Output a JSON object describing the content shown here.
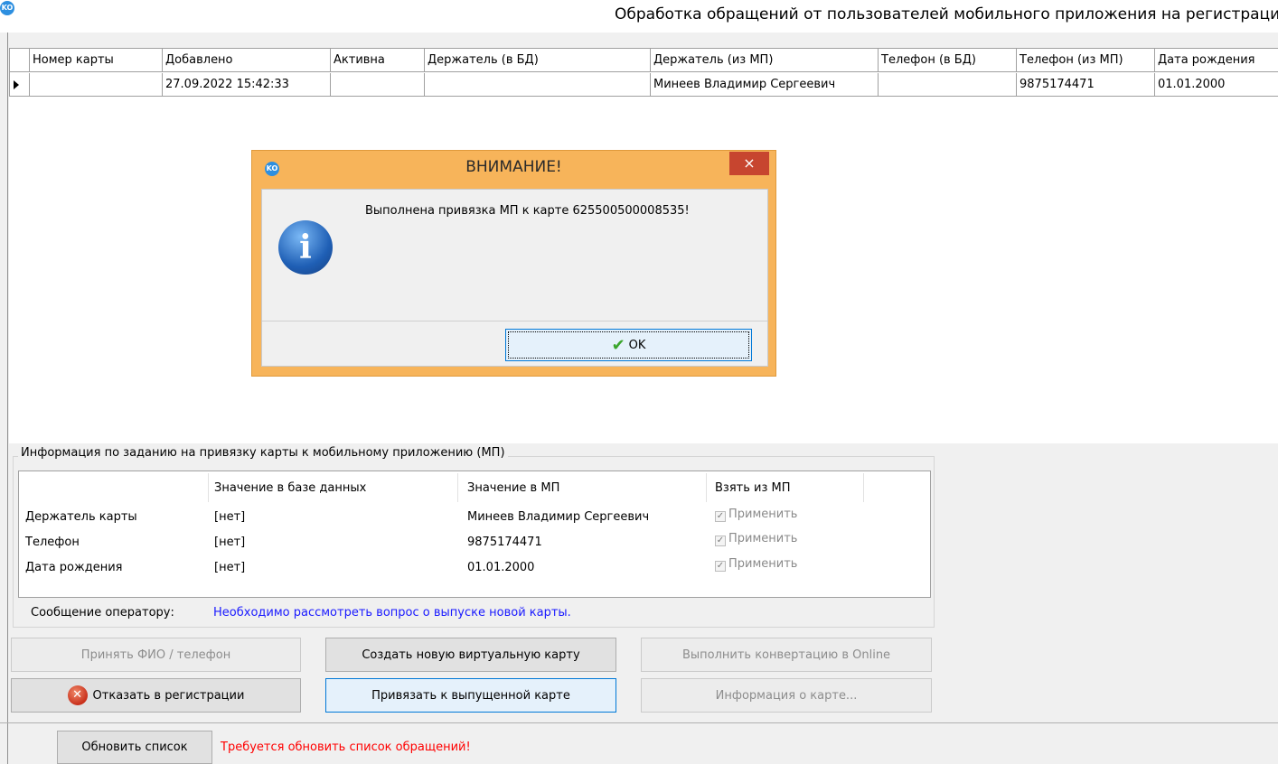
{
  "window": {
    "app_icon": "KO",
    "title": "Обработка обращений от пользователей мобильного приложения на регистрацию карт"
  },
  "grid": {
    "columns": [
      "Номер карты",
      "Добавлено",
      "Активна",
      "Держатель (в БД)",
      "Держатель (из МП)",
      "Телефон (в БД)",
      "Телефон (из МП)",
      "Дата рождения"
    ],
    "rows": [
      [
        "",
        "27.09.2022 15:42:33",
        "",
        "",
        "Минеев Владимир Сергеевич",
        "",
        "9875174471",
        "01.01.2000"
      ]
    ]
  },
  "info": {
    "group_title": "Информация по заданию на привязку карты к мобильному приложению (МП)",
    "headers": {
      "db": "Значение в базе данных",
      "mp": "Значение в МП",
      "take": "Взять из МП"
    },
    "rows": [
      {
        "label": "Держатель карты",
        "db": "[нет]",
        "mp": "Минеев Владимир Сергеевич",
        "apply": "Применить",
        "checked": true
      },
      {
        "label": "Телефон",
        "db": "[нет]",
        "mp": "9875174471",
        "apply": "Применить",
        "checked": true
      },
      {
        "label": "Дата рождения",
        "db": "[нет]",
        "mp": "01.01.2000",
        "apply": "Применить",
        "checked": true
      }
    ],
    "operator_label": "Сообщение оператору:",
    "operator_message": "Необходимо рассмотреть вопрос о выпуске новой карты."
  },
  "buttons": {
    "accept": "Принять ФИО / телефон",
    "create_virtual": "Создать новую виртуальную карту",
    "convert_online": "Выполнить конвертацию в Online",
    "reject": "Отказать в регистрации",
    "bind_issued": "Привязать к выпущенной карте",
    "card_info": "Информация о карте...",
    "refresh": "Обновить список"
  },
  "refresh_message": "Требуется обновить список обращений!",
  "dialog": {
    "icon": "KO",
    "title": "ВНИМАНИЕ!",
    "close": "×",
    "message": "Выполнена привязка МП к карте 625500500008535!",
    "info_glyph": "i",
    "ok_label": "OK"
  },
  "colors": {
    "dialog_frame": "#f7b45a",
    "operator_message": "#1a1aff",
    "warning": "#ff0000"
  }
}
